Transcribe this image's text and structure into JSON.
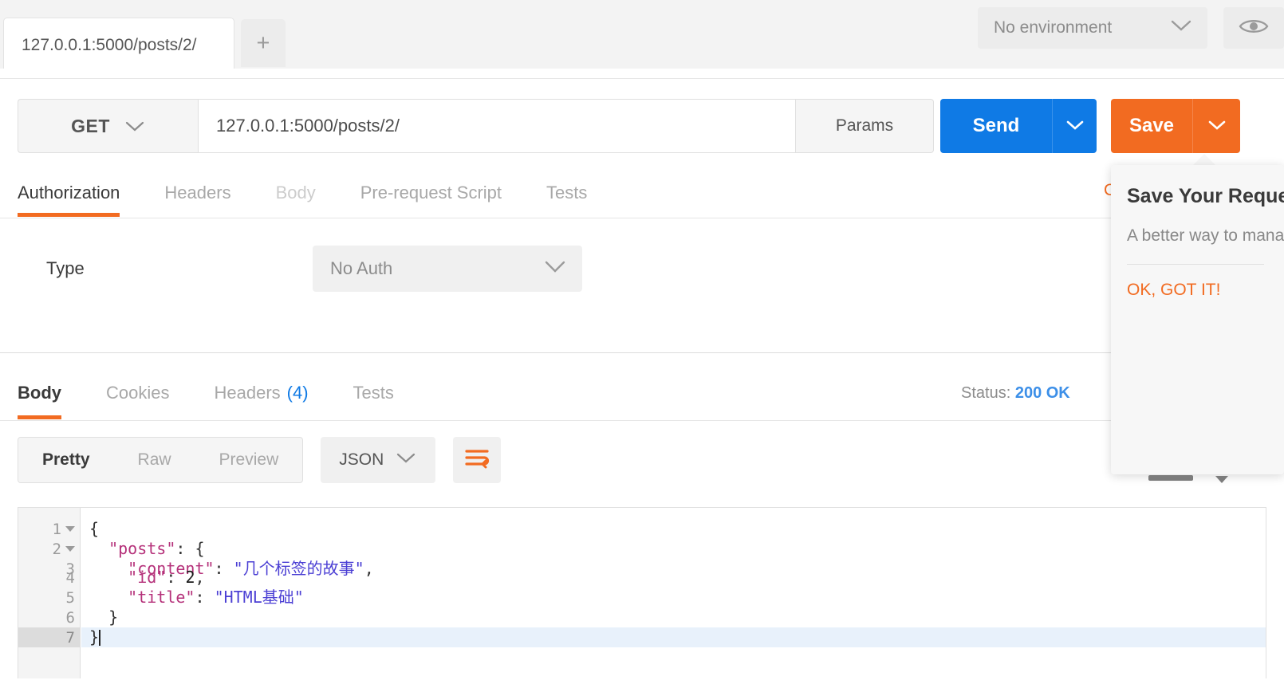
{
  "tabbar": {
    "request_tab_label": "127.0.0.1:5000/posts/2/",
    "new_tab_label": "+",
    "environment_label": "No environment",
    "eye_icon": "eye-icon"
  },
  "request": {
    "method": "GET",
    "url": "127.0.0.1:5000/posts/2/",
    "params_label": "Params",
    "send_label": "Send",
    "save_label": "Save",
    "code_link_label": "C",
    "tabs": [
      {
        "label": "Authorization",
        "state": "active"
      },
      {
        "label": "Headers",
        "state": "normal"
      },
      {
        "label": "Body",
        "state": "dim"
      },
      {
        "label": "Pre-request Script",
        "state": "normal"
      },
      {
        "label": "Tests",
        "state": "normal"
      }
    ],
    "auth": {
      "type_label": "Type",
      "type_value": "No Auth"
    }
  },
  "response": {
    "tabs": [
      {
        "label": "Body",
        "count": "",
        "state": "active"
      },
      {
        "label": "Cookies",
        "count": "",
        "state": "normal"
      },
      {
        "label": "Headers",
        "count": "(4)",
        "state": "normal"
      },
      {
        "label": "Tests",
        "count": "",
        "state": "normal"
      }
    ],
    "status_label": "Status:",
    "status_value": "200 OK",
    "view_modes": [
      {
        "label": "Pretty",
        "state": "active"
      },
      {
        "label": "Raw",
        "state": "normal"
      },
      {
        "label": "Preview",
        "state": "normal"
      }
    ],
    "format": "JSON",
    "wrap_icon": "word-wrap-icon",
    "body_lines": [
      {
        "num": "1",
        "fold": true,
        "selected": false,
        "segments": [
          {
            "t": "{",
            "c": "p"
          }
        ]
      },
      {
        "num": "2",
        "fold": true,
        "selected": false,
        "segments": [
          {
            "t": "  ",
            "c": "p"
          },
          {
            "t": "\"posts\"",
            "c": "k"
          },
          {
            "t": ": {",
            "c": "p"
          }
        ]
      },
      {
        "num": "3",
        "fold": false,
        "selected": false,
        "segments": [
          {
            "t": "    ",
            "c": "p"
          },
          {
            "t": "\"content\"",
            "c": "k"
          },
          {
            "t": ": ",
            "c": "p"
          },
          {
            "t": "\"几个标签的故事\"",
            "c": "s"
          },
          {
            "t": ",",
            "c": "p"
          }
        ]
      },
      {
        "num": "4",
        "fold": false,
        "selected": false,
        "segments": [
          {
            "t": "    ",
            "c": "p"
          },
          {
            "t": "\"id\"",
            "c": "k"
          },
          {
            "t": ": ",
            "c": "p"
          },
          {
            "t": "2",
            "c": "n"
          },
          {
            "t": ",",
            "c": "p"
          }
        ]
      },
      {
        "num": "5",
        "fold": false,
        "selected": false,
        "segments": [
          {
            "t": "    ",
            "c": "p"
          },
          {
            "t": "\"title\"",
            "c": "k"
          },
          {
            "t": ": ",
            "c": "p"
          },
          {
            "t": "\"HTML基础\"",
            "c": "s"
          }
        ]
      },
      {
        "num": "6",
        "fold": false,
        "selected": false,
        "segments": [
          {
            "t": "  }",
            "c": "p"
          }
        ]
      },
      {
        "num": "7",
        "fold": false,
        "selected": true,
        "segments": [
          {
            "t": "}",
            "c": "p"
          }
        ]
      }
    ]
  },
  "popover": {
    "title": "Save Your Request",
    "body": "A better way to manage your requests is to save it to your Collections for later reference.",
    "ok_label": "OK, GOT IT!"
  },
  "colors": {
    "accent_orange": "#f26b21",
    "send_blue": "#0f7ae5",
    "status_blue": "#3c8fe8",
    "json_key": "#b5317a",
    "json_string": "#4b3fd4"
  }
}
